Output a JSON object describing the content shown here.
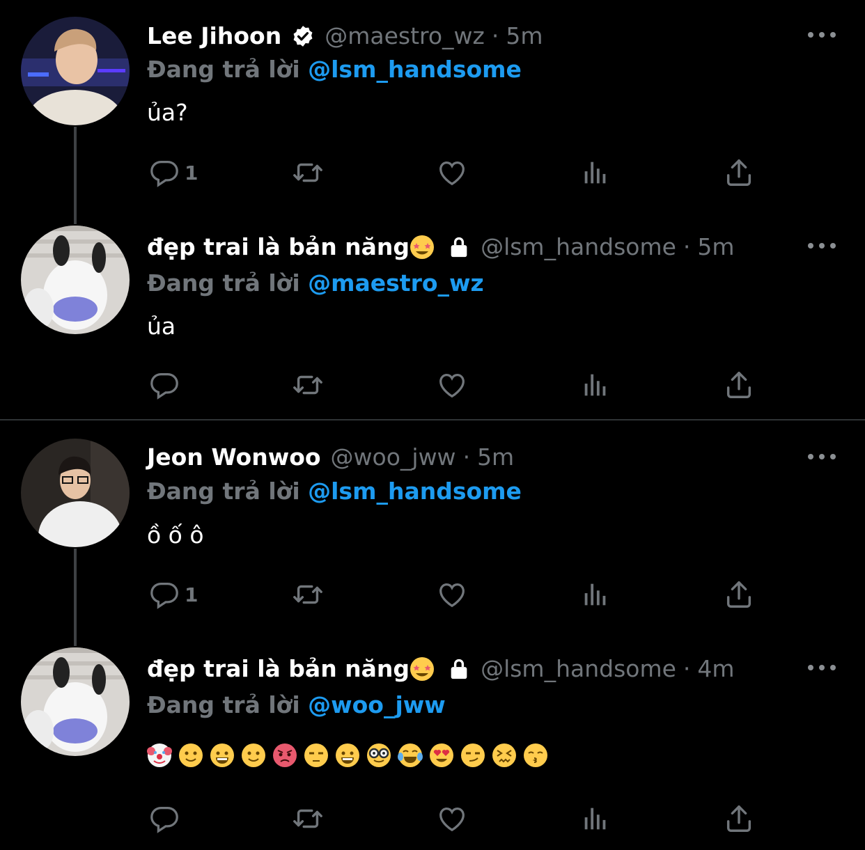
{
  "colors": {
    "background": "#000000",
    "text": "#ffffff",
    "muted": "#71767b",
    "mention": "#1d9bf0",
    "thread_line": "#3e4144",
    "separator": "#2f3336"
  },
  "tweets": [
    {
      "name": "Lee Jihoon",
      "verified": true,
      "handle": "@maestro_wz",
      "time": "5m",
      "reply_prefix": "Đang trả lời",
      "reply_to": "@lsm_handsome",
      "text": "ủa?",
      "reply_count": "1"
    },
    {
      "name": "đẹp trai là bản năng",
      "protected": true,
      "handle": "@lsm_handsome",
      "time": "5m",
      "reply_prefix": "Đang trả lời",
      "reply_to": "@maestro_wz",
      "text": "ủa",
      "reply_count": ""
    },
    {
      "name": "Jeon Wonwoo",
      "handle": "@woo_jww",
      "time": "5m",
      "reply_prefix": "Đang trả lời",
      "reply_to": "@lsm_handsome",
      "text": "ồ ố ô",
      "reply_count": "1"
    },
    {
      "name": "đẹp trai là bản năng",
      "protected": true,
      "handle": "@lsm_handsome",
      "time": "4m",
      "reply_prefix": "Đang trả lời",
      "reply_to": "@woo_jww",
      "emoji_row": [
        "clown-face",
        "slight-smile",
        "grin",
        "slight-smile",
        "angry",
        "unamused",
        "grin",
        "nerd-face",
        "tears-of-joy",
        "heart-eyes",
        "smirk",
        "confounded",
        "kissing"
      ]
    }
  ],
  "icons": {
    "reply": "reply-icon",
    "retweet": "retweet-icon",
    "like": "heart-icon",
    "analytics": "analytics-icon",
    "share": "share-icon",
    "more": "more-icon",
    "verified": "verified-badge-icon",
    "lock": "lock-icon"
  }
}
